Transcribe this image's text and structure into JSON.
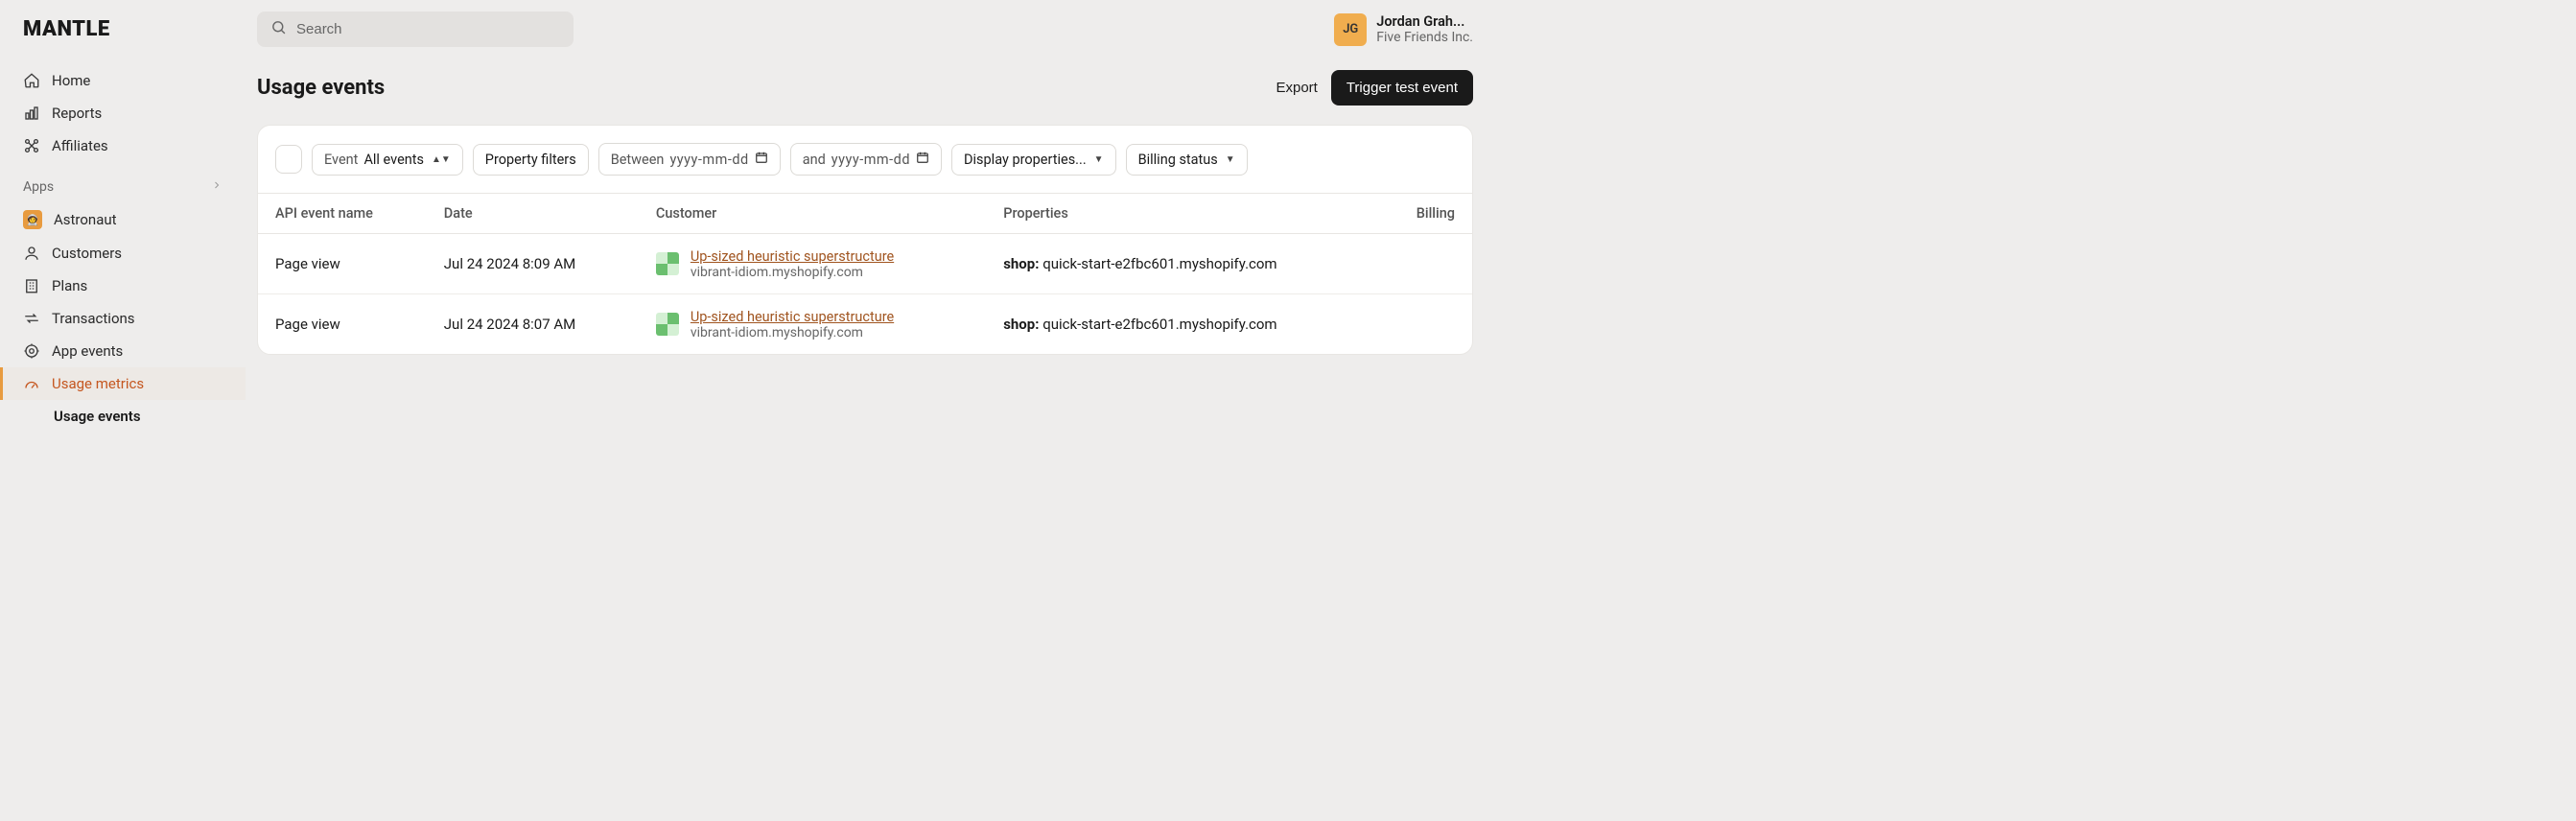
{
  "brand": "MANTLE",
  "search": {
    "placeholder": "Search"
  },
  "user": {
    "initials": "JG",
    "name": "Jordan Grah...",
    "org": "Five Friends Inc."
  },
  "nav": {
    "primary": [
      {
        "label": "Home"
      },
      {
        "label": "Reports"
      },
      {
        "label": "Affiliates"
      }
    ],
    "apps_header": "Apps",
    "app": {
      "label": "Astronaut"
    },
    "app_sub": [
      {
        "label": "Customers"
      },
      {
        "label": "Plans"
      },
      {
        "label": "Transactions"
      },
      {
        "label": "App events"
      },
      {
        "label": "Usage metrics"
      }
    ],
    "usage_events": "Usage events"
  },
  "page": {
    "title": "Usage events",
    "export": "Export",
    "trigger": "Trigger test event"
  },
  "filters": {
    "event_label": "Event",
    "event_value": "All events",
    "property_filters": "Property filters",
    "between": "Between",
    "date_placeholder": "yyyy-mm-dd",
    "and": "and",
    "display_props": "Display properties...",
    "billing_status": "Billing status"
  },
  "table": {
    "headers": {
      "api": "API event name",
      "date": "Date",
      "customer": "Customer",
      "properties": "Properties",
      "billing": "Billing"
    },
    "rows": [
      {
        "event": "Page view",
        "date": "Jul 24 2024 8:09 AM",
        "customer_name": "Up-sized heuristic superstructure",
        "customer_sub": "vibrant-idiom.myshopify.com",
        "prop_key": "shop:",
        "prop_val": "quick-start-e2fbc601.myshopify.com"
      },
      {
        "event": "Page view",
        "date": "Jul 24 2024 8:07 AM",
        "customer_name": "Up-sized heuristic superstructure",
        "customer_sub": "vibrant-idiom.myshopify.com",
        "prop_key": "shop:",
        "prop_val": "quick-start-e2fbc601.myshopify.com"
      }
    ]
  }
}
